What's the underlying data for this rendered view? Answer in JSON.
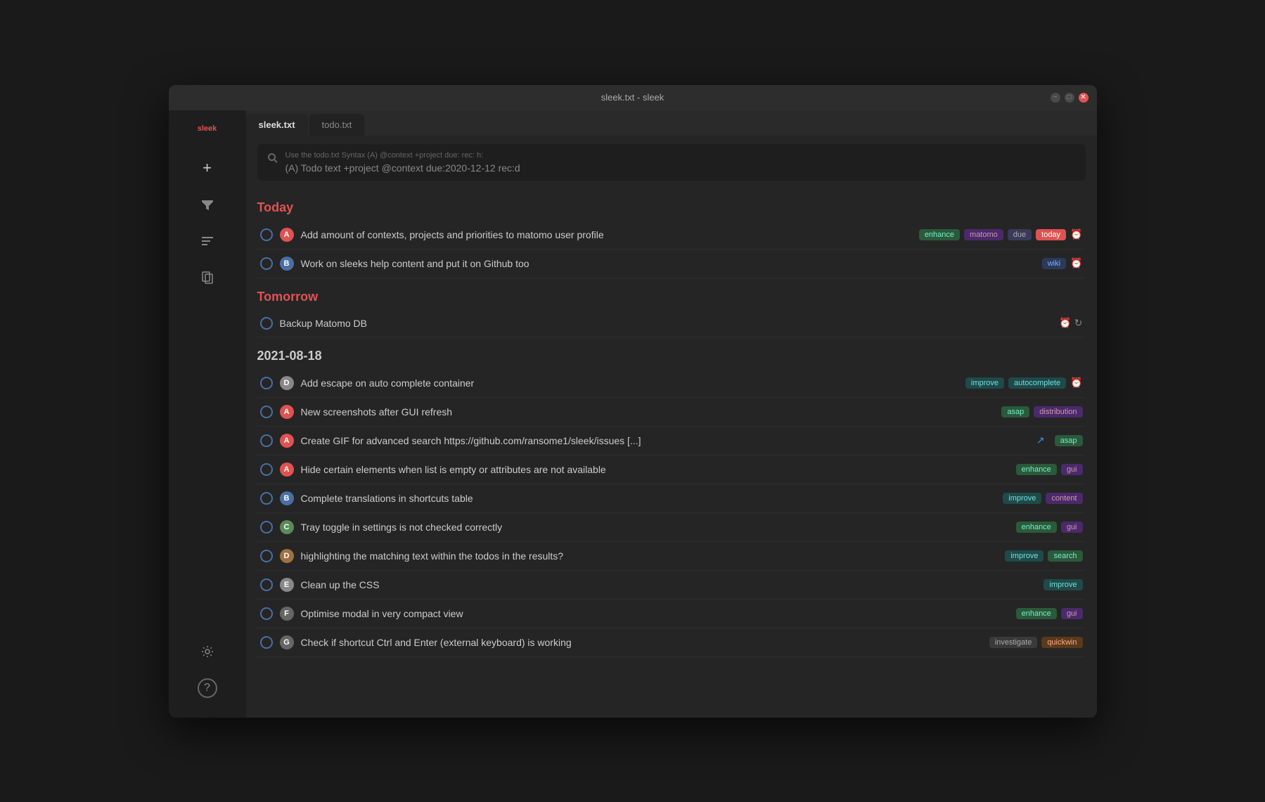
{
  "window": {
    "title": "sleek.txt - sleek",
    "controls": {
      "minimize": "−",
      "maximize": "□",
      "close": "✕"
    }
  },
  "tabs": [
    {
      "label": "sleek.txt",
      "active": true
    },
    {
      "label": "todo.txt",
      "active": false
    }
  ],
  "search": {
    "hint": "Use the todo.txt Syntax (A) @context +project due: rec: h:",
    "placeholder": "(A) Todo text +project @context due:2020-12-12 rec:d",
    "icon": "🔍"
  },
  "sidebar": {
    "logo": "sleek",
    "icons": [
      {
        "name": "add-icon",
        "glyph": "+",
        "label": "Add"
      },
      {
        "name": "filter-icon",
        "glyph": "⊘",
        "label": "Filter"
      },
      {
        "name": "sort-icon",
        "glyph": "≡",
        "label": "Sort"
      },
      {
        "name": "files-icon",
        "glyph": "🗂",
        "label": "Files"
      }
    ],
    "bottom_icons": [
      {
        "name": "settings-icon",
        "glyph": "⚙",
        "label": "Settings"
      },
      {
        "name": "help-icon",
        "glyph": "?",
        "label": "Help"
      }
    ]
  },
  "sections": [
    {
      "header": "Today",
      "header_class": "today",
      "items": [
        {
          "text": "Add amount of contexts, projects and priorities to matomo user profile",
          "priority": "A",
          "priority_class": "priority-a",
          "tags": [
            {
              "label": "enhance",
              "class": "tag-green"
            },
            {
              "label": "matomo",
              "class": "tag-purple"
            }
          ],
          "extra_tags": [
            {
              "label": "due",
              "class": "tag-due"
            },
            {
              "label": "today",
              "class": "tag-today"
            }
          ],
          "due_icon": true,
          "due_icon_type": "red"
        },
        {
          "text": "Work on sleeks help content and put it on Github too",
          "priority": "B",
          "priority_class": "priority-b",
          "tags": [
            {
              "label": "wiki",
              "class": "tag-blue"
            }
          ],
          "due_icon": true,
          "due_icon_type": "red"
        }
      ]
    },
    {
      "header": "Tomorrow",
      "header_class": "tomorrow",
      "items": [
        {
          "text": "Backup Matomo DB",
          "priority": null,
          "tags": [],
          "due_icon": true,
          "due_icon_type": "red",
          "recur_icon": true
        }
      ]
    },
    {
      "header": "2021-08-18",
      "header_class": "date",
      "items": [
        {
          "text": "Add escape on auto complete container",
          "priority": "D",
          "priority_class": "priority-e",
          "tags": [
            {
              "label": "improve",
              "class": "tag-teal"
            },
            {
              "label": "autocomplete",
              "class": "tag-teal"
            }
          ],
          "due_icon": true,
          "due_icon_type": "gray"
        },
        {
          "text": "New screenshots after GUI refresh",
          "priority": "A",
          "priority_class": "priority-a",
          "tags": [
            {
              "label": "asap",
              "class": "tag-green"
            },
            {
              "label": "distribution",
              "class": "tag-purple"
            }
          ]
        },
        {
          "text": "Create GIF for advanced search https://github.com/ransome1/sleek/issues [...]",
          "priority": "A",
          "priority_class": "priority-a",
          "external_link": true,
          "tags": [
            {
              "label": "asap",
              "class": "tag-green"
            }
          ]
        },
        {
          "text": "Hide certain elements when list is empty or attributes are not available",
          "priority": "A",
          "priority_class": "priority-a",
          "tags": [
            {
              "label": "enhance",
              "class": "tag-green"
            },
            {
              "label": "gui",
              "class": "tag-purple"
            }
          ]
        },
        {
          "text": "Complete translations in shortcuts table",
          "priority": "B",
          "priority_class": "priority-b",
          "tags": [
            {
              "label": "improve",
              "class": "tag-teal"
            },
            {
              "label": "content",
              "class": "tag-purple"
            }
          ]
        },
        {
          "text": "Tray toggle in settings is not checked correctly",
          "priority": "C",
          "priority_class": "priority-c",
          "tags": [
            {
              "label": "enhance",
              "class": "tag-green"
            },
            {
              "label": "gui",
              "class": "tag-purple"
            }
          ]
        },
        {
          "text": "highlighting the matching text within the todos in the results?",
          "priority": "D",
          "priority_class": "priority-d",
          "tags": [
            {
              "label": "improve",
              "class": "tag-teal"
            },
            {
              "label": "search",
              "class": "tag-green"
            }
          ]
        },
        {
          "text": "Clean up the CSS",
          "priority": "E",
          "priority_class": "priority-e",
          "tags": [
            {
              "label": "improve",
              "class": "tag-teal"
            }
          ]
        },
        {
          "text": "Optimise modal in very compact view",
          "priority": "F",
          "priority_class": "priority-g",
          "tags": [
            {
              "label": "enhance",
              "class": "tag-green"
            },
            {
              "label": "gui",
              "class": "tag-purple"
            }
          ]
        },
        {
          "text": "Check if shortcut Ctrl and Enter (external keyboard) is working",
          "priority": "G",
          "priority_class": "priority-g",
          "tags": [
            {
              "label": "investigate",
              "class": "tag-gray"
            },
            {
              "label": "quickwin",
              "class": "tag-orange"
            }
          ]
        }
      ]
    }
  ]
}
